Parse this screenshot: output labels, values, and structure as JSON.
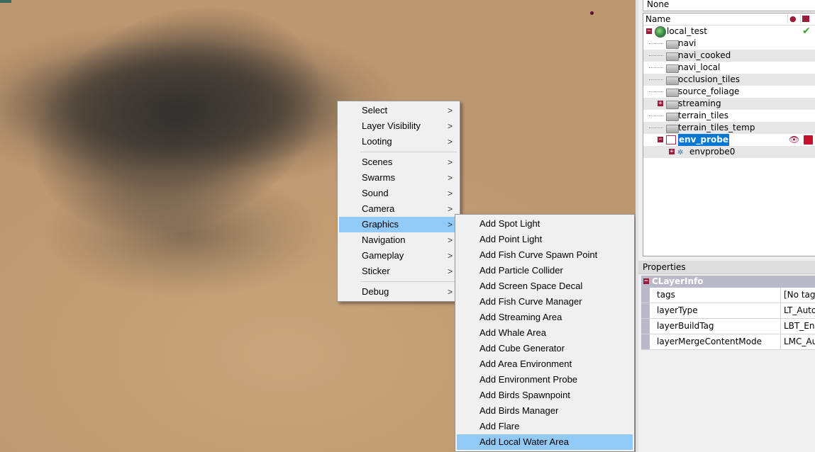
{
  "viewport": {
    "background": "sand terrain with dark blob shadow"
  },
  "context_menu": {
    "items": [
      {
        "label": "Select",
        "submenu": true
      },
      {
        "label": "Layer Visibility",
        "submenu": true
      },
      {
        "label": "Looting",
        "submenu": true
      },
      {
        "separator": true
      },
      {
        "label": "Scenes",
        "submenu": true
      },
      {
        "label": "Swarms",
        "submenu": true
      },
      {
        "label": "Sound",
        "submenu": true
      },
      {
        "label": "Camera",
        "submenu": true
      },
      {
        "label": "Graphics",
        "submenu": true,
        "highlighted": true
      },
      {
        "label": "Navigation",
        "submenu": true
      },
      {
        "label": "Gameplay",
        "submenu": true
      },
      {
        "label": "Sticker",
        "submenu": true
      },
      {
        "separator": true
      },
      {
        "label": "Debug",
        "submenu": true
      }
    ],
    "arrow_glyph": ">"
  },
  "graphics_submenu": {
    "items": [
      "Add Spot Light",
      "Add Point Light",
      "Add Fish Curve Spawn Point",
      "Add Particle Collider",
      "Add Screen Space Decal",
      "Add Fish Curve Manager",
      "Add Streaming Area",
      "Add Whale Area",
      "Add Cube Generator",
      "Add Area Environment",
      "Add Environment Probe",
      "Add Birds Spawnpoint",
      "Add Birds Manager",
      "Add Flare",
      "Add Local Water Area"
    ],
    "highlighted_index": 14
  },
  "right_panel": {
    "filter_value": "None",
    "tree": {
      "header_name": "Name",
      "root": "local_test",
      "folders": [
        "navi",
        "navi_cooked",
        "navi_local",
        "occlusion_tiles",
        "source_foliage",
        "streaming",
        "terrain_tiles",
        "terrain_tiles_temp"
      ],
      "selected_layer": "env_probe",
      "child": "envprobe0",
      "expand_collapsed": "+",
      "expand_open": "−"
    },
    "properties": {
      "title": "Properties",
      "category": "CLayerInfo",
      "rows": [
        {
          "name": "tags",
          "value": "[No tag"
        },
        {
          "name": "layerType",
          "value": "LT_Auto"
        },
        {
          "name": "layerBuildTag",
          "value": "LBT_Env"
        },
        {
          "name": "layerMergeContentMode",
          "value": "LMC_Au"
        }
      ]
    }
  },
  "colors": {
    "menu_highlight": "#91c9f7",
    "selection": "#0078d7",
    "expander": "#9b1b3a",
    "sand": "#c4a077"
  }
}
